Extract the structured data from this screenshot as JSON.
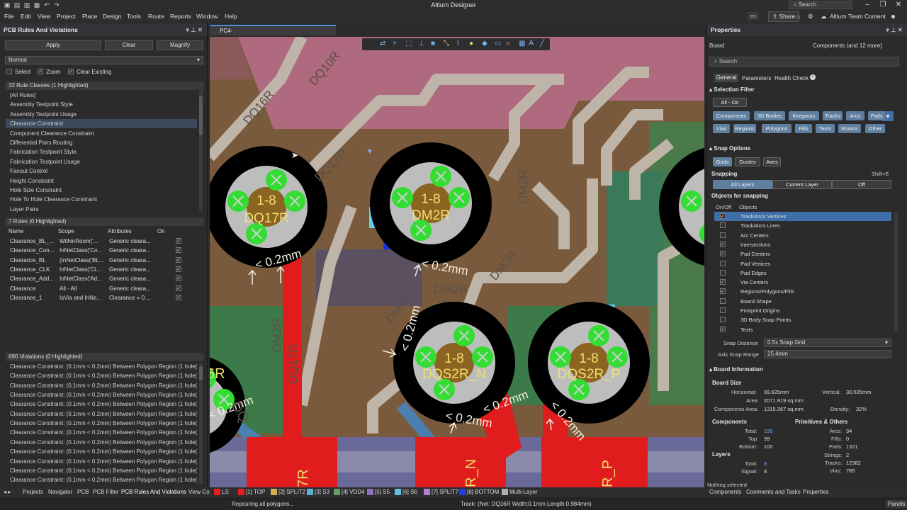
{
  "app": {
    "title": "Altium Designer",
    "search": "Search",
    "user": "Altium Team Content",
    "share": "Share"
  },
  "menu": [
    "File",
    "Edit",
    "View",
    "Project",
    "Place",
    "Design",
    "Tools",
    "Route",
    "Reports",
    "Window",
    "Help"
  ],
  "left": {
    "title": "PCB Rules And Violations",
    "apply": "Apply",
    "clear": "Clear",
    "magnify": "Magnify",
    "mode": "Normal",
    "opt_select": "Select",
    "opt_zoom": "Zoom",
    "opt_clear_existing": "Clear Existing",
    "rule_classes_header": "32 Rule Classes (1 Highlighted)",
    "rule_classes": [
      "[All Rules]",
      "Assembly Testpoint Style",
      "Assembly Testpoint Usage",
      "Clearance Constraint",
      "Component Clearance Constraint",
      "Differential Pairs Routing",
      "Fabrication Testpoint Style",
      "Fabrication Testpoint Usage",
      "Fanout Control",
      "Height Constraint",
      "Hole Size Constraint",
      "Hole To Hole Clearance Constraint",
      "Layer Pairs"
    ],
    "rules_header": "7 Rules (0 Highlighted)",
    "rules_cols": [
      "Name",
      "Scope",
      "Attributes",
      "On"
    ],
    "rules": [
      [
        "Clearance_BL_...",
        "WithinRoom('...",
        "Generic cleara..."
      ],
      [
        "Clearance_Con...",
        "InNetClass('Co...",
        "Generic cleara..."
      ],
      [
        "Clearance_BL",
        "(InNetClass('BL...",
        "Generic cleara..."
      ],
      [
        "Clearance_CLK",
        "InNetClass('CL...",
        "Generic cleara..."
      ],
      [
        "Clearance_Add...",
        "InNetClass('Ad...",
        "Generic cleara..."
      ],
      [
        "Clearance",
        "All - All",
        "Generic cleara..."
      ],
      [
        "Clearance_1",
        "IsVia and InNe...",
        "Clearance = 0...."
      ]
    ],
    "violations_header": "690 Violations (0 Highlighted)",
    "violation_text": "Clearance Constraint: (0.1mm < 0.2mm) Between Polygon Region (1 hole(s..."
  },
  "doc_tab": "PC4-SODIMM_V200_RC_A1_20141015.PcbDoc *",
  "canvas": {
    "pads": [
      {
        "pin": "1-8",
        "net": "DQ17R"
      },
      {
        "pin": "1-8",
        "net": "DM2R"
      },
      {
        "pin": "1-8",
        "net": "DQS2R_N"
      },
      {
        "pin": "1-8",
        "net": "DQS2R_P"
      }
    ],
    "labels": [
      "DQ16R",
      "DQ10R",
      "DQ17R",
      "DM2R",
      "DM2R",
      "DM2R",
      "DM2R",
      "DQ17R",
      "DM2R",
      "< 0.2mm",
      "< 0.2mm",
      "< 0.2mm",
      "< 0.2mm",
      "< 0.2mm",
      "< 0.2mm",
      "< 0.2mm",
      "7R",
      "R_N",
      "R_P",
      "6R",
      "DQ"
    ]
  },
  "right": {
    "title": "Properties",
    "board": "Board",
    "components_count": "Components (and 12 more)",
    "search": "Search",
    "tabs": [
      "General",
      "Parameters",
      "Health Check"
    ],
    "selection_filter": "Selection Filter",
    "all_on": "All - On",
    "filters": [
      "Components",
      "3D Bodies",
      "Keepouts",
      "Tracks",
      "Arcs",
      "Pads",
      "Vias",
      "Regions",
      "Polygons",
      "Fills",
      "Texts",
      "Rooms",
      "Other"
    ],
    "snap_options": "Snap Options",
    "snap_btns": [
      "Grids",
      "Guides",
      "Axes"
    ],
    "snapping": "Snapping",
    "snapping_key": "Shift+E",
    "snap_modes": [
      "All Layers",
      "Current Layer",
      "Off"
    ],
    "objects_for_snapping": "Objects for snapping",
    "obj_cols": [
      "On/Off",
      "Objects"
    ],
    "objects": [
      {
        "name": "Track/Arcs Vertices",
        "on": true
      },
      {
        "name": "Track/Arcs Lines",
        "on": false
      },
      {
        "name": "Arc Centers",
        "on": false
      },
      {
        "name": "Intersections",
        "on": true
      },
      {
        "name": "Pad Centers",
        "on": true
      },
      {
        "name": "Pad Vertices",
        "on": false
      },
      {
        "name": "Pad Edges",
        "on": false
      },
      {
        "name": "Via Centers",
        "on": true
      },
      {
        "name": "Regions/Polygons/Fills",
        "on": true
      },
      {
        "name": "Board Shape",
        "on": false
      },
      {
        "name": "Footprint Origins",
        "on": false
      },
      {
        "name": "3D Body Snap Points",
        "on": false
      },
      {
        "name": "Texts",
        "on": true
      }
    ],
    "snap_distance_label": "Snap Distance",
    "snap_distance": "0.5x Snap Grid",
    "axis_snap_label": "Axis Snap Range",
    "axis_snap": "25.4mm",
    "board_info": "Board Information",
    "board_size": "Board Size",
    "horizontal_l": "Horizontal:",
    "horizontal": "69.625mm",
    "vertical_l": "Vertical:",
    "vertical": "30.025mm",
    "area_l": "Area:",
    "area": "2071.919 sq.mm",
    "comp_area_l": "Components Area:",
    "comp_area": "1315.367 sq.mm",
    "density_l": "Density:",
    "density": "32%",
    "components": "Components",
    "prims": "Primitives & Others",
    "total_l": "Total:",
    "total": "199",
    "top_l": "Top:",
    "top": "99",
    "bottom_l": "Bottom:",
    "bottom": "100",
    "arcs_l": "Arcs:",
    "arcs": "34",
    "fills_l": "Fills:",
    "fills": "0",
    "pads_l": "Pads:",
    "pads": "1321",
    "strings_l": "Strings:",
    "strings": "2",
    "tracks_l": "Tracks:",
    "tracks": "12382",
    "vias_l": "Vias:",
    "vias": "785",
    "layers": "Layers",
    "ltotal_l": "Total:",
    "ltotal": "8",
    "signal_l": "Signal:",
    "signal": "8",
    "nothing_selected": "Nothing selected"
  },
  "bottom_tabs": [
    "Projects",
    "Navigator",
    "PCB",
    "PCB Filter",
    "PCB Rules And Violations",
    "View Co"
  ],
  "layers": [
    {
      "name": "LS",
      "color": "#e02020"
    },
    {
      "name": "[1] TOP",
      "color": "#e02020"
    },
    {
      "name": "[2] SPLIT2",
      "color": "#d4b050"
    },
    {
      "name": "[3] S3",
      "color": "#5fb0d0"
    },
    {
      "name": "[4] VDD4",
      "color": "#60a060"
    },
    {
      "name": "[5] S5",
      "color": "#9070c0"
    },
    {
      "name": "[6] S6",
      "color": "#60c0e0"
    },
    {
      "name": "[7] SPLIT7",
      "color": "#b080d0"
    },
    {
      "name": "[8] BOTTOM",
      "color": "#2040e0"
    },
    {
      "name": "Multi-Layer",
      "color": "#b0b0b0"
    }
  ],
  "right_bottom_tabs": [
    "Components",
    "Comments and Tasks",
    "Properties"
  ],
  "status": {
    "left": "Repouring all polygons...",
    "center": "Track: (Net: DQ16R Width:0.1mm Length:0.984mm)",
    "right": "Panels"
  }
}
